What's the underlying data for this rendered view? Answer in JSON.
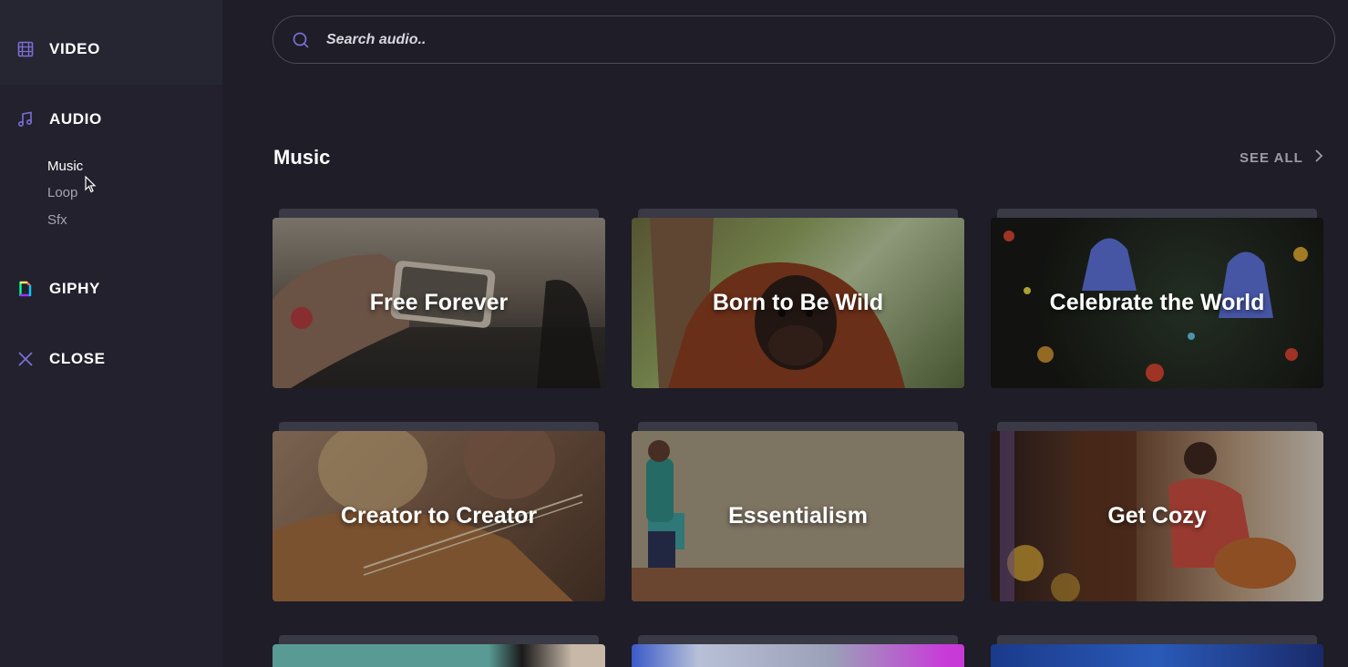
{
  "sidebar": {
    "video": {
      "label": "VIDEO",
      "icon": "film-icon"
    },
    "audio": {
      "label": "AUDIO",
      "icon": "music-note-icon",
      "subitems": [
        {
          "label": "Music",
          "active": true
        },
        {
          "label": "Loop",
          "active": false
        },
        {
          "label": "Sfx",
          "active": false
        }
      ]
    },
    "giphy": {
      "label": "GIPHY",
      "icon": "giphy-icon"
    },
    "close": {
      "label": "CLOSE",
      "icon": "close-icon"
    }
  },
  "search": {
    "placeholder": "Search audio..",
    "value": ""
  },
  "section": {
    "title": "Music",
    "see_all_label": "SEE ALL"
  },
  "cards": [
    {
      "title": "Free Forever"
    },
    {
      "title": "Born to Be Wild"
    },
    {
      "title": "Celebrate the World"
    },
    {
      "title": "Creator to Creator"
    },
    {
      "title": "Essentialism"
    },
    {
      "title": "Get Cozy"
    },
    {
      "title": ""
    },
    {
      "title": ""
    },
    {
      "title": ""
    }
  ],
  "colors": {
    "background": "#1e1d28",
    "sidebar": "#22212d",
    "accent": "#7b6fd6"
  }
}
